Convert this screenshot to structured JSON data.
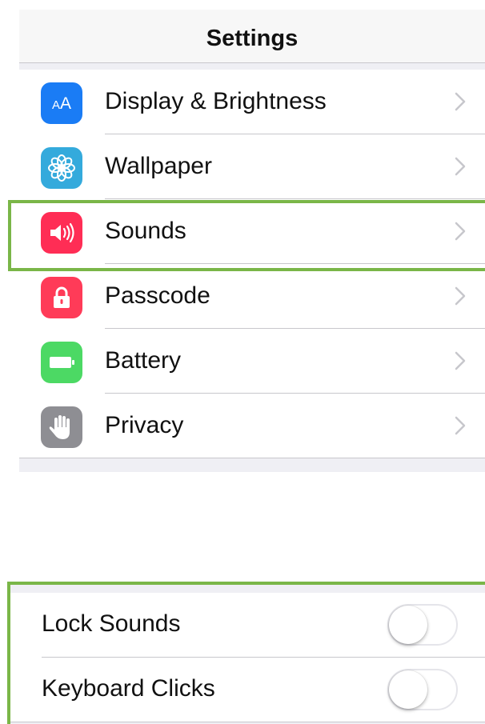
{
  "header": {
    "title": "Settings"
  },
  "settings_items": [
    {
      "label": "Display & Brightness",
      "icon": "display-brightness-icon",
      "icon_color": "#1a7cf5"
    },
    {
      "label": "Wallpaper",
      "icon": "wallpaper-flower-icon",
      "icon_color": "#34aadc"
    },
    {
      "label": "Sounds",
      "icon": "speaker-icon",
      "icon_color": "#ff2d55",
      "highlighted": true
    },
    {
      "label": "Passcode",
      "icon": "lock-icon",
      "icon_color": "#ff3b58"
    },
    {
      "label": "Battery",
      "icon": "battery-icon",
      "icon_color": "#4cd964"
    },
    {
      "label": "Privacy",
      "icon": "hand-icon",
      "icon_color": "#8e8e93"
    }
  ],
  "sound_toggles": [
    {
      "label": "Lock Sounds",
      "on": false
    },
    {
      "label": "Keyboard Clicks",
      "on": false
    }
  ],
  "colors": {
    "highlight": "#7ab648",
    "separator": "#c8c7cc",
    "group_background": "#efeff4"
  }
}
